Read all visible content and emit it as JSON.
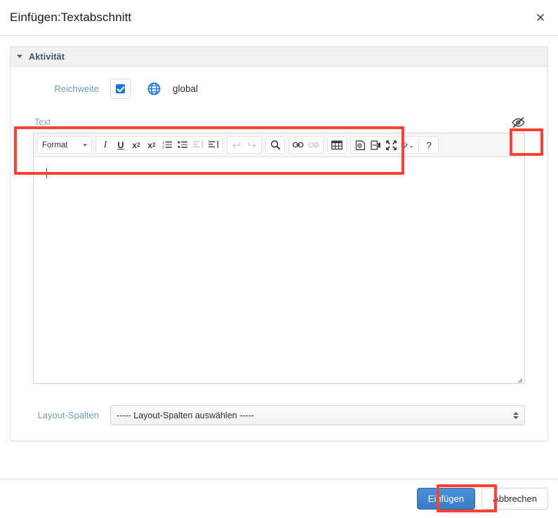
{
  "dialog": {
    "title": "Einfügen:Textabschnitt",
    "close_icon": "close-icon",
    "close_glyph": "✕"
  },
  "panel": {
    "title": "Aktivität",
    "caret_icon": "chevron-down-icon"
  },
  "scope": {
    "label": "Reichweite",
    "checkbox_checked": true,
    "globe_icon": "globe-icon",
    "value": "global"
  },
  "text_section": {
    "label": "Text",
    "visibility_toggle_icon": "eye-slash-icon"
  },
  "toolbar": {
    "format": {
      "label": "Format",
      "caret_icon": "chevron-down-icon"
    },
    "groups": [
      {
        "name": "formatting",
        "buttons": [
          {
            "name": "italic-icon",
            "glyph": "I"
          },
          {
            "name": "underline-icon",
            "glyph": "U"
          },
          {
            "name": "subscript-icon",
            "glyph": "x₂"
          },
          {
            "name": "superscript-icon",
            "glyph": "x²"
          },
          {
            "name": "numbered-list-icon",
            "glyph": "☰"
          },
          {
            "name": "bulleted-list-icon",
            "glyph": "☰"
          },
          {
            "name": "outdent-icon",
            "glyph": "⇤",
            "disabled": true
          },
          {
            "name": "indent-icon",
            "glyph": "⇥"
          }
        ]
      },
      {
        "name": "history",
        "buttons": [
          {
            "name": "undo-icon",
            "glyph": "↶",
            "disabled": true
          },
          {
            "name": "redo-icon",
            "glyph": "↷",
            "disabled": true
          }
        ]
      },
      {
        "name": "search",
        "buttons": [
          {
            "name": "search-icon",
            "glyph": "🔍"
          }
        ]
      },
      {
        "name": "links",
        "buttons": [
          {
            "name": "link-icon",
            "glyph": "🔗"
          },
          {
            "name": "unlink-icon",
            "glyph": "🔗",
            "disabled": true
          }
        ]
      },
      {
        "name": "table",
        "buttons": [
          {
            "name": "table-icon",
            "glyph": "▦"
          }
        ]
      },
      {
        "name": "tools",
        "buttons": [
          {
            "name": "template-icon",
            "glyph": "▤"
          },
          {
            "name": "page-break-icon",
            "glyph": "▥"
          },
          {
            "name": "maximize-icon",
            "glyph": "⛶"
          },
          {
            "name": "spellcheck-icon",
            "glyph": "ABC"
          },
          {
            "name": "help-icon",
            "glyph": "?"
          }
        ]
      }
    ]
  },
  "editor": {
    "content": "",
    "caret_visible": true,
    "resize_handle": "resize-grip-icon"
  },
  "layout_columns": {
    "label": "Layout-Spalten",
    "selected": "----- Layout-Spalten auswählen -----",
    "arrows_icon": "select-arrows-icon"
  },
  "footer": {
    "submit_label": "Einfügen",
    "cancel_label": "Abbrechen"
  },
  "annotations": {
    "accent_color": "#fc4133",
    "regions": [
      "text-toolbar-region",
      "visibility-toggle-region",
      "submit-button-region"
    ]
  },
  "colors": {
    "label_blue": "#6f9cba",
    "primary_button": "#3a7cc4",
    "checkbox_blue": "#1a73e8",
    "globe_blue": "#1a73e8",
    "panel_header_bg": "#f1f1f2",
    "annotation_red": "#fc4133"
  }
}
